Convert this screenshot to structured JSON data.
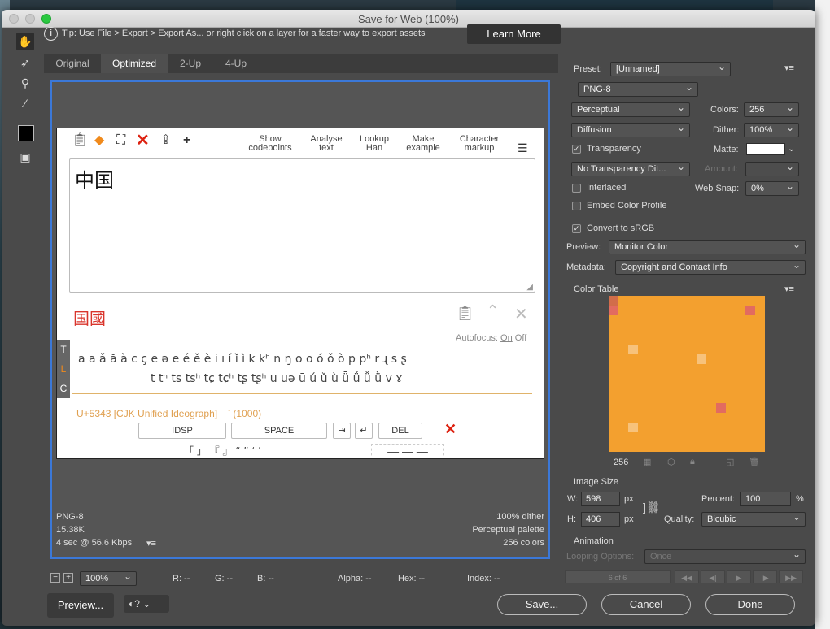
{
  "window": {
    "title": "Save for Web (100%)"
  },
  "tip": {
    "text": "Tip: Use File > Export > Export As...  or right click on a layer for a faster way to export assets",
    "learn_more": "Learn More"
  },
  "tabs": [
    "Original",
    "Optimized",
    "2-Up",
    "4-Up"
  ],
  "webpage": {
    "buttons": [
      {
        "l1": "Show",
        "l2": "codepoints"
      },
      {
        "l1": "Analyse",
        "l2": "text"
      },
      {
        "l1": "Lookup",
        "l2": "Han"
      },
      {
        "l1": "Make",
        "l2": "example"
      },
      {
        "l1": "Character",
        "l2": "markup"
      }
    ],
    "input_text": "中国",
    "han_variants": "国國",
    "autofocus_label": "Autofocus:",
    "autofocus_on": "On",
    "autofocus_off": "Off",
    "side_tabs": [
      "T",
      "L",
      "C"
    ],
    "char_row1": "a ā ǎ ă à   c ç   e ə ē é ě è   i ī í ǐ ì   k kʰ   n ŋ   o ō ó ǒ ò   p pʰ   r ɻ   s ʂ",
    "char_row2": "t tʰ ts tsʰ tɕ tɕʰ tʂ tʂʰ   u uə ū ú ǔ ù ǖ ǘ ǚ ǜ   v ɤ",
    "codepoint_info": "U+5343 [CJK Unified Ideograph]",
    "codepoint_extra": "ᵗ (1000)",
    "keys": [
      "IDSP",
      "SPACE",
      "⇥",
      "↵",
      "DEL"
    ],
    "punct_row": "「 」 『 』 “ ” ‘ ’"
  },
  "preview_footer": {
    "format": "PNG-8",
    "size": "15.38K",
    "time": "4 sec @ 56.6 Kbps",
    "dither": "100% dither",
    "palette": "Perceptual palette",
    "colors": "256 colors"
  },
  "settings": {
    "preset_label": "Preset:",
    "preset_value": "[Unnamed]",
    "format": "PNG-8",
    "reduction": "Perceptual",
    "colors_label": "Colors:",
    "colors_value": "256",
    "dither_algo": "Diffusion",
    "dither_label": "Dither:",
    "dither_value": "100%",
    "transparency": "Transparency",
    "matte_label": "Matte:",
    "no_transparency_dither": "No Transparency Dit...",
    "amount_label": "Amount:",
    "interlaced": "Interlaced",
    "web_snap_label": "Web Snap:",
    "web_snap_value": "0%",
    "embed_profile": "Embed Color Profile",
    "convert_srgb": "Convert to sRGB",
    "preview_label": "Preview:",
    "preview_value": "Monitor Color",
    "metadata_label": "Metadata:",
    "metadata_value": "Copyright and Contact Info",
    "color_table_label": "Color Table",
    "color_count": "256",
    "image_size_label": "Image Size",
    "w_label": "W:",
    "w_value": "598",
    "h_label": "H:",
    "h_value": "406",
    "px": "px",
    "percent_label": "Percent:",
    "percent_value": "100",
    "percent_sign": "%",
    "quality_label": "Quality:",
    "quality_value": "Bicubic",
    "animation_label": "Animation",
    "looping_label": "Looping Options:",
    "looping_value": "Once",
    "frame": "6 of 6"
  },
  "status": {
    "zoom": "100%",
    "r": "R: --",
    "g": "G: --",
    "b": "B: --",
    "alpha": "Alpha: --",
    "hex": "Hex: --",
    "index": "Index: --"
  },
  "buttons": {
    "preview": "Preview...",
    "save": "Save...",
    "cancel": "Cancel",
    "done": "Done"
  },
  "colors": {
    "accent_blue": "#3b78d8",
    "badge_orange": "#f08a1c",
    "han_red": "#d9352c"
  }
}
